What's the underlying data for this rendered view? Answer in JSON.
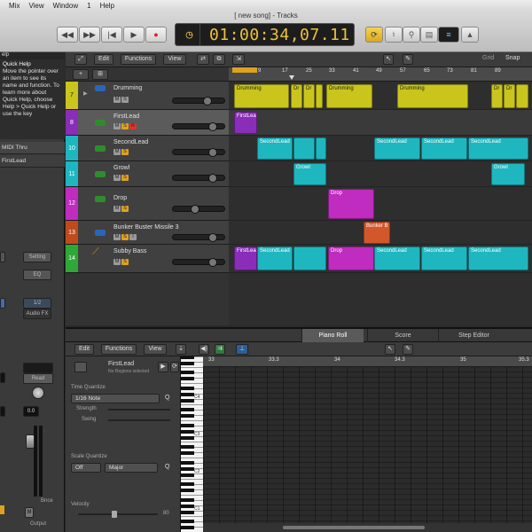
{
  "menubar": {
    "items": [
      "Mix",
      "View",
      "Window",
      "1",
      "Help"
    ]
  },
  "window": {
    "title": "[ new song] - Tracks"
  },
  "transport": {
    "time": "01:00:34,07.11",
    "clock_icon": "clock-icon"
  },
  "right_controls": {
    "cpu": "≡"
  },
  "inspector": {
    "help_title": "Quick Help",
    "help_text": "Move the pointer over an item to see its name and function. To learn more about Quick Help, choose Help > Quick Help or use the key",
    "help_partial": "elp",
    "midi_thru": "MIDI Thru",
    "region_name": "FirstLead",
    "setting": "Setting",
    "eq": "EQ",
    "input": "1/2",
    "send": "Audio FX",
    "read": "Read",
    "pan_value": "0.0",
    "bounce": "Bnce",
    "output": "Output",
    "m_btn": "M"
  },
  "tracks_header": {
    "add": "+",
    "edit": "Edit",
    "functions": "Functions",
    "view": "View"
  },
  "tracks": [
    {
      "num": "7",
      "name": "Drumming",
      "color": "#c9c51c",
      "icon_color": "#2a66b8"
    },
    {
      "num": "8",
      "name": "FirstLead",
      "color": "#8a2db8",
      "icon_color": "#2e8c2e"
    },
    {
      "num": "10",
      "name": "SecondLead",
      "color": "#1eb7c0",
      "icon_color": "#2e8c2e"
    },
    {
      "num": "11",
      "name": "Growl",
      "color": "#1eb7c0",
      "icon_color": "#2e8c2e"
    },
    {
      "num": "12",
      "name": "Drop",
      "color": "#c02bc0",
      "icon_color": "#2e8c2e"
    },
    {
      "num": "13",
      "name": "Bunker Buster Missile 3",
      "color": "#c04a1c",
      "icon_color": "#2a66b8"
    },
    {
      "num": "14",
      "name": "Subby Bass",
      "color": "#2ea836",
      "icon_color": "#c7952a"
    }
  ],
  "arrange": {
    "grid_label": "Grid",
    "snap_label": "Snap",
    "ruler": [
      "9",
      "17",
      "25",
      "33",
      "41",
      "49",
      "57",
      "65",
      "73",
      "81",
      "89"
    ],
    "cycle_start": "1"
  },
  "regions": {
    "drumming": [
      "Drumming",
      "Dr",
      "Dr",
      "Drumming",
      "Drumming",
      "Dr",
      "Dr"
    ],
    "firstlead": [
      "FirstLead"
    ],
    "secondlead": [
      "SecondLead",
      "SecondLead",
      "SecondLead",
      "SecondLead"
    ],
    "growl": [
      "Growl",
      "Growl"
    ],
    "drop": [
      "Drop"
    ],
    "bunker": [
      "Bunker B"
    ],
    "subby": [
      "FirstLead",
      "SecondLead",
      "Drop",
      "SecondLead",
      "SecondLead",
      "SecondLead"
    ]
  },
  "editor": {
    "tabs": [
      "Piano Roll",
      "Score",
      "Step Editor"
    ],
    "edit": "Edit",
    "functions": "Functions",
    "view": "View",
    "region_name": "FirstLead",
    "region_sub": "No Regions selected",
    "time_quantize": "Time Quantize",
    "quant_value": "1/16 Note",
    "q": "Q",
    "strength": "Strength",
    "swing": "Swing",
    "scale_quantize": "Scale Quantize",
    "scale_off": "Off",
    "scale_major": "Major",
    "velocity": "Velocity",
    "velocity_value": "80",
    "ruler": [
      "33",
      "33.3",
      "34",
      "34.3",
      "35",
      "35.3"
    ],
    "key_labels": [
      "C4",
      "C3",
      "C2",
      "C1"
    ]
  }
}
